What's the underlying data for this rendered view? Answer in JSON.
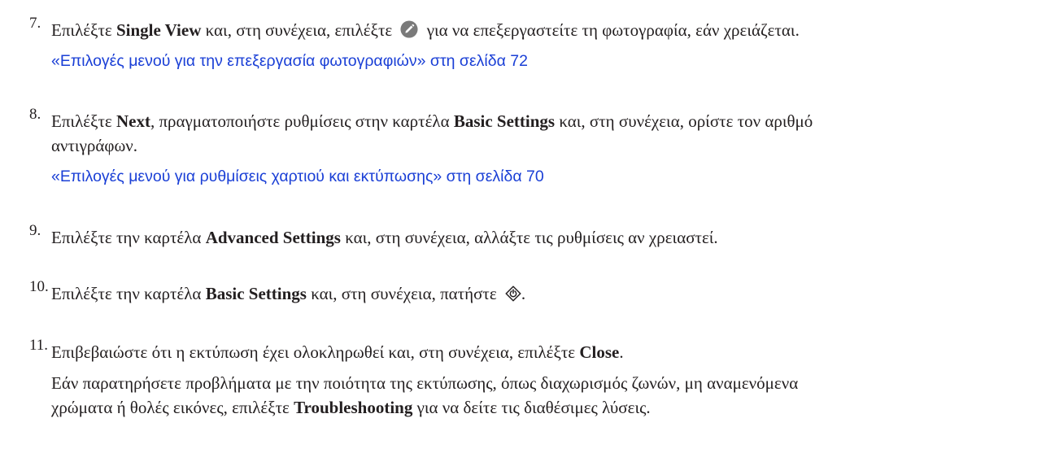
{
  "steps": [
    {
      "number": "7.",
      "lines": [
        [
          {
            "text": "Επιλέξτε ",
            "bold": false
          },
          {
            "text": "Single View",
            "bold": true
          },
          {
            "text": " και, στη συνέχεια, επιλέξτε ",
            "bold": false
          },
          {
            "icon": "edit-pencil-icon"
          },
          {
            "text": " για να επεξεργαστείτε τη φωτογραφία, εάν χρειάζεται.",
            "bold": false
          }
        ]
      ],
      "link": "«Επιλογές μενού για την επεξεργασία φωτογραφιών» στη σελίδα 72"
    },
    {
      "number": "8.",
      "lines": [
        [
          {
            "text": "Επιλέξτε ",
            "bold": false
          },
          {
            "text": "Next",
            "bold": true
          },
          {
            "text": ", πραγματοποιήστε ρυθμίσεις στην καρτέλα ",
            "bold": false
          },
          {
            "text": "Basic Settings",
            "bold": true
          },
          {
            "text": " και, στη συνέχεια, ορίστε τον αριθμό",
            "bold": false
          }
        ],
        [
          {
            "text": "αντιγράφων.",
            "bold": false
          }
        ]
      ],
      "link": "«Επιλογές μενού για ρυθμίσεις χαρτιού και εκτύπωσης» στη σελίδα 70"
    },
    {
      "number": "9.",
      "lines": [
        [
          {
            "text": "Επιλέξτε την καρτέλα ",
            "bold": false
          },
          {
            "text": "Advanced Settings",
            "bold": true
          },
          {
            "text": " και, στη συνέχεια, αλλάξτε τις ρυθμίσεις αν χρειαστεί.",
            "bold": false
          }
        ]
      ]
    },
    {
      "number": "10.",
      "lines": [
        [
          {
            "text": "Επιλέξτε την καρτέλα ",
            "bold": false
          },
          {
            "text": "Basic Settings",
            "bold": true
          },
          {
            "text": " και, στη συνέχεια, πατήστε ",
            "bold": false
          },
          {
            "icon": "start-button-icon"
          },
          {
            "text": ".",
            "bold": false
          }
        ]
      ]
    },
    {
      "number": "11.",
      "lines": [
        [
          {
            "text": "Επιβεβαιώστε ότι η εκτύπωση έχει ολοκληρωθεί και, στη συνέχεια, επιλέξτε ",
            "bold": false
          },
          {
            "text": "Close",
            "bold": true
          },
          {
            "text": ".",
            "bold": false
          }
        ]
      ],
      "note": [
        [
          {
            "text": "Εάν παρατηρήσετε προβλήματα με την ποιότητα της εκτύπωσης, όπως διαχωρισμός ζωνών, μη αναμενόμενα",
            "bold": false
          }
        ],
        [
          {
            "text": "χρώματα ή θολές εικόνες, επιλέξτε ",
            "bold": false
          },
          {
            "text": "Troubleshooting",
            "bold": true
          },
          {
            "text": " για να δείτε τις διαθέσιμες λύσεις.",
            "bold": false
          }
        ]
      ]
    }
  ],
  "colors": {
    "text": "#231f20",
    "link": "#1a3fd6",
    "icon_fill": "#7a7a7a"
  }
}
